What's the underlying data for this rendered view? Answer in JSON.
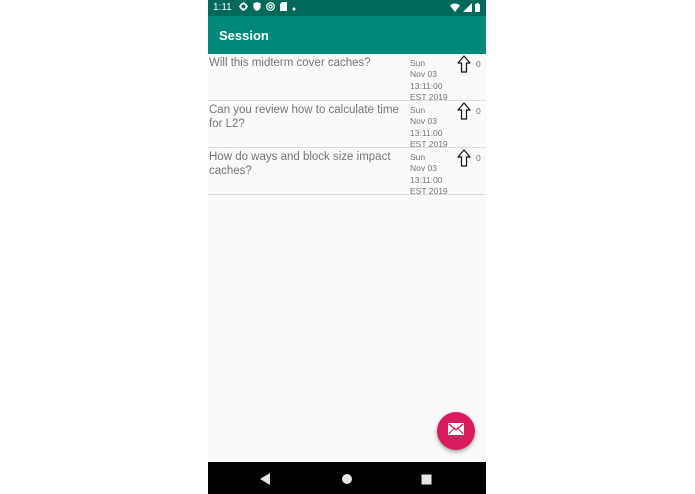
{
  "status_bar": {
    "time": "1:11",
    "left_icons": [
      "gear-icon",
      "shield-icon",
      "at-sign-icon",
      "sd-card-icon",
      "dot-icon"
    ],
    "right_icons": [
      "wifi-icon",
      "signal-icon",
      "battery-icon"
    ]
  },
  "app_bar": {
    "title": "Session"
  },
  "questions": [
    {
      "text": "Will this midterm cover caches?",
      "date": "Sun\nNov 03\n13:11:00\nEST 2019",
      "votes": "0"
    },
    {
      "text": "Can you review how to calculate time for L2?",
      "date": "Sun\nNov 03\n13:11:00\nEST 2019",
      "votes": "0"
    },
    {
      "text": "How do ways and block size impact caches?",
      "date": "Sun\nNov 03\n13:11:00\nEST 2019",
      "votes": "0"
    }
  ],
  "fab": {
    "icon": "mail-icon"
  },
  "nav_bar": {
    "buttons": [
      "back-icon",
      "home-icon",
      "recents-icon"
    ]
  },
  "colors": {
    "status_bar": "#00695c",
    "app_bar": "#00897b",
    "fab": "#d81b60",
    "background": "#fafafa"
  }
}
